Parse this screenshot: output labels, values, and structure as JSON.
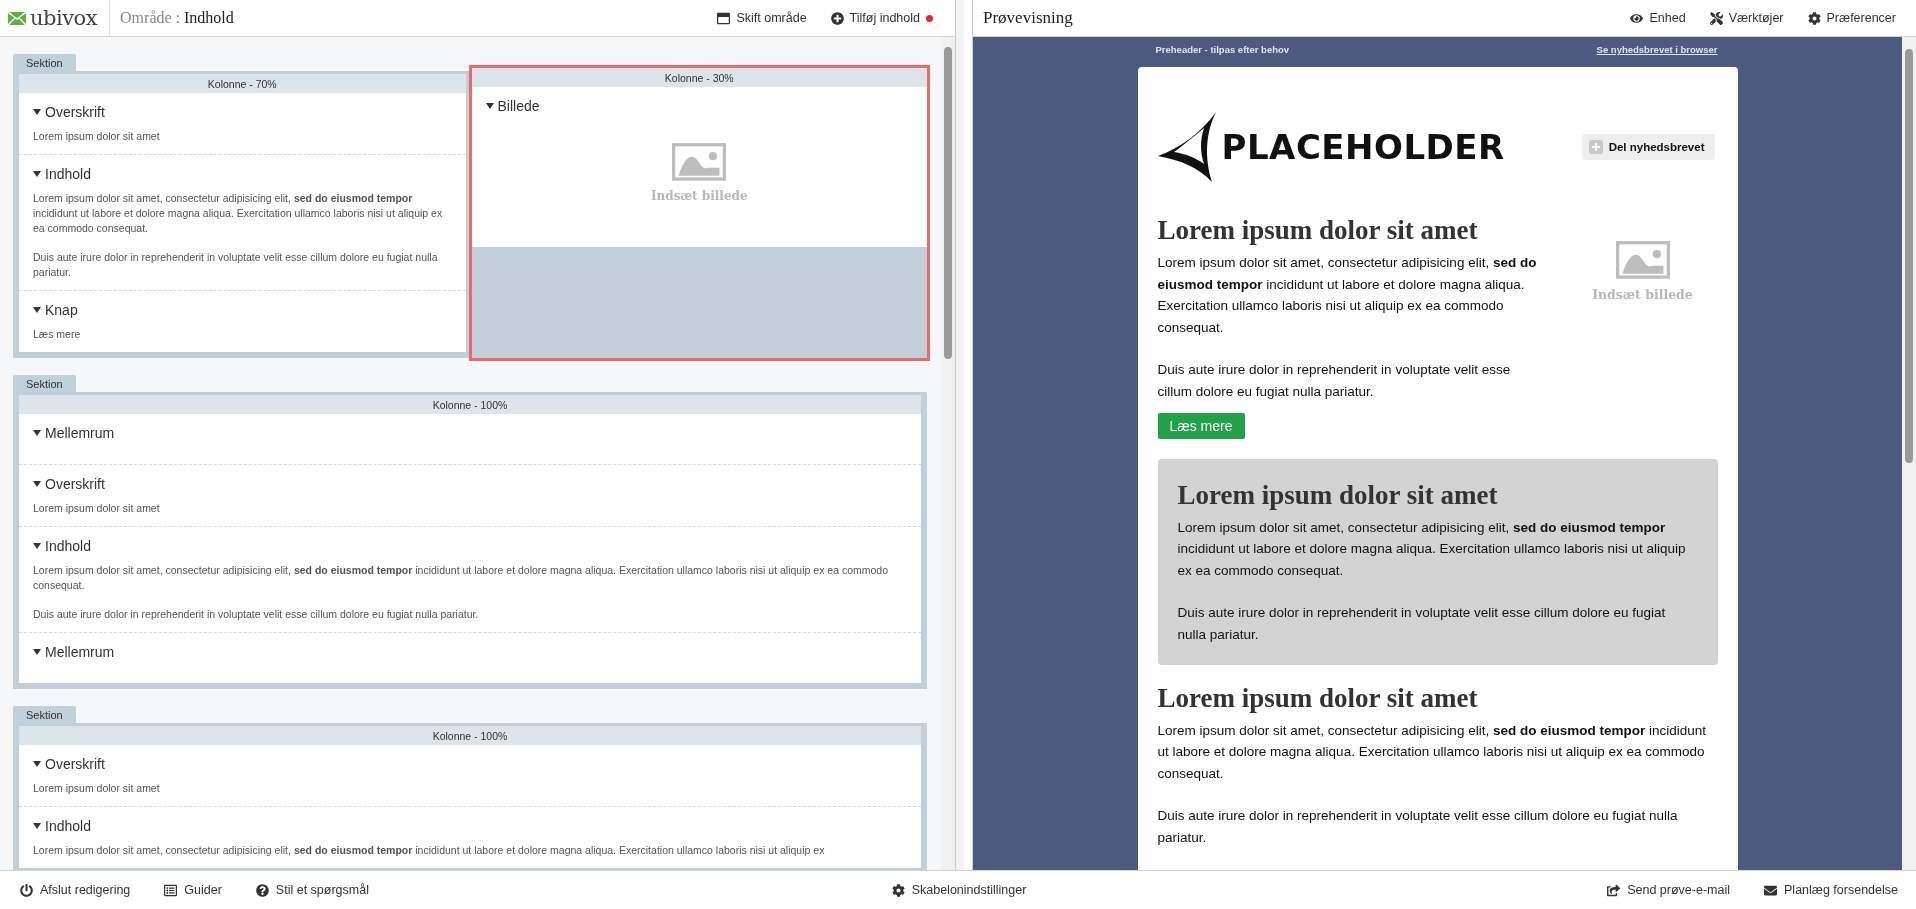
{
  "header": {
    "logo": "ubivox",
    "area_label": "Område :",
    "area_value": "Indhold",
    "actions": [
      {
        "label": "Skift område",
        "notification": false
      },
      {
        "label": "Tilføj indhold",
        "notification": true
      }
    ]
  },
  "preview_header": {
    "title": "Prøvevisning",
    "actions": [
      {
        "label": "Enhed"
      },
      {
        "label": "Værktøjer"
      },
      {
        "label": "Præferencer"
      }
    ]
  },
  "editor": {
    "sections": [
      {
        "label": "Sektion",
        "columns": [
          {
            "label": "Kolonne - 70%",
            "selected": false,
            "blocks": [
              {
                "kind": "text",
                "title": "Overskrift",
                "paragraphs": [
                  "Lorem ipsum dolor sit amet"
                ]
              },
              {
                "kind": "text",
                "title": "Indhold",
                "paragraphs": [
                  "Lorem ipsum dolor sit amet, consectetur adipisicing elit, **sed do eiusmod tempor** incididunt ut labore et dolore magna aliqua. Exercitation ullamco laboris nisi ut aliquip ex ea commodo consequat.",
                  "Duis aute irure dolor in reprehenderit in voluptate velit esse cillum dolore eu fugiat nulla pariatur."
                ]
              },
              {
                "kind": "text",
                "title": "Knap",
                "paragraphs": [
                  "Læs mere"
                ]
              }
            ]
          },
          {
            "label": "Kolonne - 30%",
            "selected": true,
            "blocks": [
              {
                "kind": "image",
                "title": "Billede",
                "caption": "Indsæt billede"
              }
            ]
          }
        ]
      },
      {
        "label": "Sektion",
        "columns": [
          {
            "label": "Kolonne - 100%",
            "selected": false,
            "blocks": [
              {
                "kind": "spacer",
                "title": "Mellemrum"
              },
              {
                "kind": "text",
                "title": "Overskrift",
                "paragraphs": [
                  "Lorem ipsum dolor sit amet"
                ]
              },
              {
                "kind": "text",
                "title": "Indhold",
                "paragraphs": [
                  "Lorem ipsum dolor sit amet, consectetur adipisicing elit, **sed do eiusmod tempor** incididunt ut labore et dolore magna aliqua. Exercitation ullamco laboris nisi ut aliquip ex ea commodo consequat.",
                  "Duis aute irure dolor in reprehenderit in voluptate velit esse cillum dolore eu fugiat nulla pariatur."
                ]
              },
              {
                "kind": "spacer",
                "title": "Mellemrum"
              }
            ]
          }
        ]
      },
      {
        "label": "Sektion",
        "columns": [
          {
            "label": "Kolonne - 100%",
            "selected": false,
            "blocks": [
              {
                "kind": "text",
                "title": "Overskrift",
                "paragraphs": [
                  "Lorem ipsum dolor sit amet"
                ]
              },
              {
                "kind": "text",
                "title": "Indhold",
                "paragraphs": [
                  "Lorem ipsum dolor sit amet, consectetur adipisicing elit, **sed do eiusmod tempor** incididunt ut labore et dolore magna aliqua. Exercitation ullamco laboris nisi ut aliquip ex"
                ]
              }
            ]
          }
        ]
      }
    ]
  },
  "preview": {
    "preheader": "Preheader - tilpas efter behov",
    "browser_link": "Se nyhedsbrevet i browser",
    "logo_text": "PLACEHOLDER",
    "share_button": "Del nyhedsbrevet",
    "articles": [
      {
        "kind": "image_right",
        "heading": "Lorem ipsum dolor sit amet",
        "paragraphs": [
          "Lorem ipsum dolor sit amet, consectetur adipisicing elit, **sed do eiusmod tempor** incididunt ut labore et dolore magna aliqua. Exercitation ullamco laboris nisi ut aliquip ex ea commodo consequat.",
          "Duis aute irure dolor in reprehenderit in voluptate velit esse cillum dolore eu fugiat nulla pariatur."
        ],
        "button": "Læs mere",
        "image_caption": "Indsæt billede"
      },
      {
        "kind": "boxed",
        "heading": "Lorem ipsum dolor sit amet",
        "paragraphs": [
          "Lorem ipsum dolor sit amet, consectetur adipisicing elit, **sed do eiusmod tempor** incididunt ut labore et dolore magna aliqua. Exercitation ullamco laboris nisi ut aliquip ex ea commodo consequat.",
          "Duis aute irure dolor in reprehenderit in voluptate velit esse cillum dolore eu fugiat nulla pariatur."
        ]
      },
      {
        "kind": "plain",
        "heading": "Lorem ipsum dolor sit amet",
        "paragraphs": [
          "Lorem ipsum dolor sit amet, consectetur adipisicing elit, **sed do eiusmod tempor** incididunt ut labore et dolore magna aliqua. Exercitation ullamco laboris nisi ut aliquip ex ea commodo consequat.",
          "Duis aute irure dolor in reprehenderit in voluptate velit esse cillum dolore eu fugiat nulla pariatur."
        ]
      }
    ]
  },
  "footer": {
    "left": [
      {
        "label": "Afslut redigering"
      },
      {
        "label": "Guider"
      },
      {
        "label": "Stil et spørgsmål"
      }
    ],
    "center": [
      {
        "label": "Skabelonindstillinger"
      }
    ],
    "right": [
      {
        "label": "Send prøve-e-mail"
      },
      {
        "label": "Planlæg forsendelse"
      }
    ]
  }
}
